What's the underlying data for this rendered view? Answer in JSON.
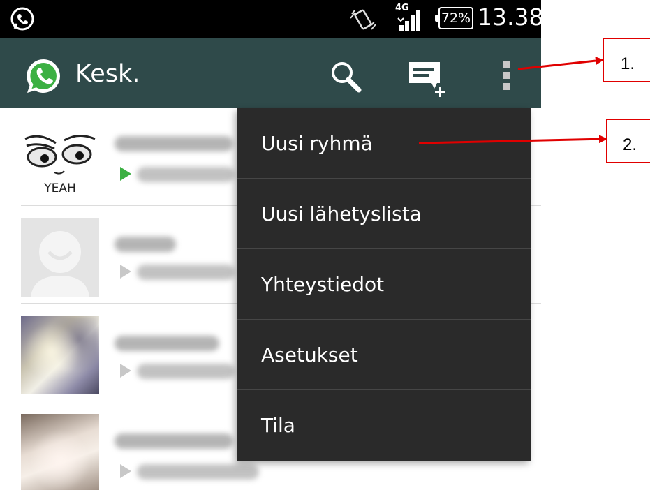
{
  "status_bar": {
    "network": "4G",
    "battery": "72%",
    "time": "13.38",
    "icons": [
      "whatsapp-notification-icon",
      "vibrate-icon",
      "signal-icon",
      "battery-icon"
    ]
  },
  "action_bar": {
    "title": "Kesk.",
    "icons": [
      "whatsapp-logo-icon",
      "search-icon",
      "new-chat-icon",
      "overflow-menu-icon"
    ]
  },
  "chat_list": {
    "rows": [
      {
        "avatar": "eyes-yeah-avatar",
        "avatar_text": "YEAH",
        "indicator_color": "#3cb043"
      },
      {
        "avatar": "default-contact-avatar",
        "indicator_color": "#c8c8c8"
      },
      {
        "avatar": "photo-avatar",
        "indicator_color": "#c8c8c8"
      },
      {
        "avatar": "photo-avatar",
        "indicator_color": "#c8c8c8"
      }
    ]
  },
  "menu": {
    "items": [
      {
        "label": "Uusi ryhmä"
      },
      {
        "label": "Uusi lähetyslista"
      },
      {
        "label": "Yhteystiedot"
      },
      {
        "label": "Asetukset"
      },
      {
        "label": "Tila"
      }
    ]
  },
  "annotations": [
    {
      "label": "1."
    },
    {
      "label": "2."
    }
  ],
  "colors": {
    "action_bar": "#2f4a4a",
    "menu_bg": "#2a2a2a",
    "accent_green": "#3cb043",
    "annotation_red": "#e00000"
  }
}
